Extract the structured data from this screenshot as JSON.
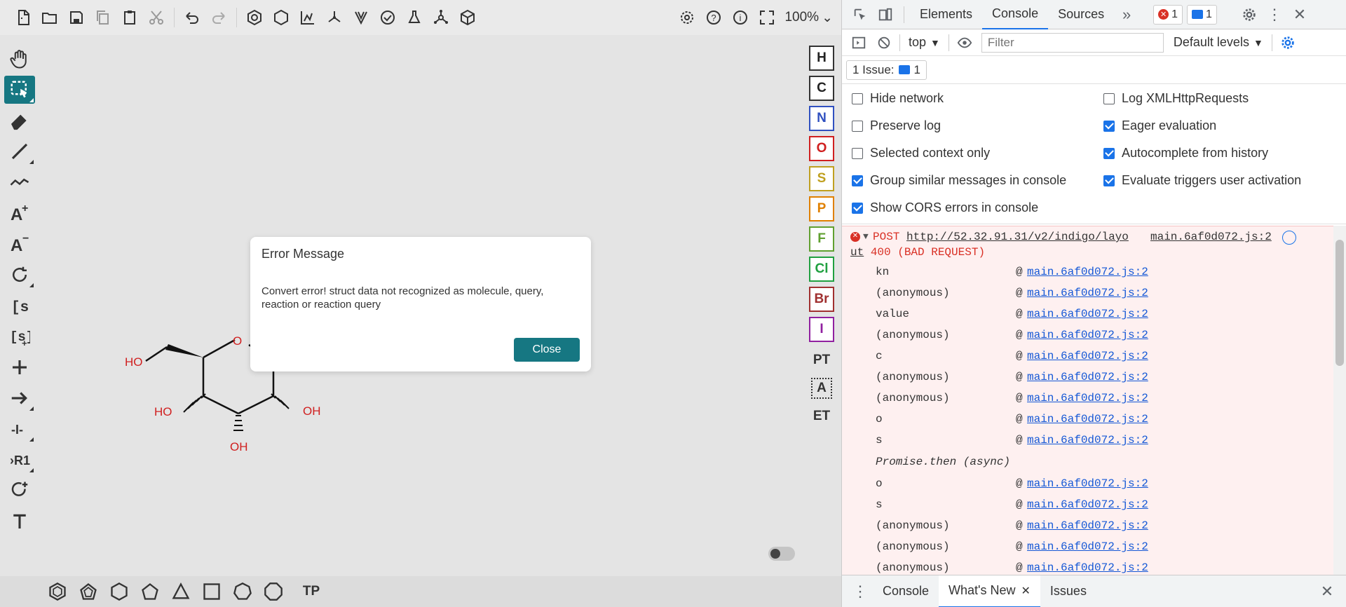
{
  "editor": {
    "top_toolbar": {
      "icons": [
        "new-icon",
        "open-icon",
        "save-icon",
        "copy-icon",
        "paste-icon",
        "cut-icon",
        "undo-icon",
        "redo-icon",
        "aromatize-icon",
        "dearomatize-icon",
        "layout-icon",
        "clean-icon",
        "stereo-icon",
        "check-icon",
        "calculate-icon",
        "explicit-h-icon",
        "3d-icon"
      ],
      "right_icons": [
        "settings-icon",
        "help-icon",
        "about-icon",
        "fullscreen-icon"
      ],
      "zoom": "100%"
    },
    "left_tools": [
      "hand",
      "select",
      "erase",
      "bond",
      "chain",
      "charge-plus",
      "charge-minus",
      "rotate",
      "sgroup",
      "sgroup-add",
      "plus",
      "arrow",
      "bracket",
      "rgroup",
      "rgroup-attach",
      "text"
    ],
    "atoms": [
      {
        "label": "H",
        "color": "#222222"
      },
      {
        "label": "C",
        "color": "#222222"
      },
      {
        "label": "N",
        "color": "#3050c0"
      },
      {
        "label": "O",
        "color": "#d02020"
      },
      {
        "label": "S",
        "color": "#c0a020"
      },
      {
        "label": "P",
        "color": "#e08000"
      },
      {
        "label": "F",
        "color": "#60a030"
      },
      {
        "label": "Cl",
        "color": "#20a040"
      },
      {
        "label": "Br",
        "color": "#a03030"
      },
      {
        "label": "I",
        "color": "#9020a0"
      }
    ],
    "right_extras": {
      "periodic": "PT",
      "any_atom": "A",
      "extended": "ET"
    },
    "bottom_shapes": [
      "benzene",
      "cyclopentadiene",
      "cyclohexane",
      "cyclopentane",
      "cyclopropane",
      "cyclobutane",
      "cycloheptane",
      "cyclooctane"
    ],
    "bottom_template": "TP",
    "molecule_labels": {
      "ho1": "HO",
      "o_ring": "O",
      "ho2": "HO",
      "oh3": "OH",
      "oh4": "OH"
    },
    "dialog": {
      "title": "Error Message",
      "body": "Convert error! struct data not recognized as molecule, query, reaction or reaction query",
      "close": "Close"
    }
  },
  "devtools": {
    "tabs": [
      "Elements",
      "Console",
      "Sources"
    ],
    "active_tab": "Console",
    "error_count": "1",
    "message_count": "1",
    "context": "top",
    "filter_placeholder": "Filter",
    "levels": "Default levels",
    "issues_label": "1 Issue:",
    "issues_count": "1",
    "settings_left": [
      {
        "label": "Hide network",
        "checked": false
      },
      {
        "label": "Preserve log",
        "checked": false
      },
      {
        "label": "Selected context only",
        "checked": false
      },
      {
        "label": "Group similar messages in console",
        "checked": true
      },
      {
        "label": "Show CORS errors in console",
        "checked": true
      }
    ],
    "settings_right": [
      {
        "label": "Log XMLHttpRequests",
        "checked": false
      },
      {
        "label": "Eager evaluation",
        "checked": true
      },
      {
        "label": "Autocomplete from history",
        "checked": true
      },
      {
        "label": "Evaluate triggers user activation",
        "checked": true
      }
    ],
    "error": {
      "method": "POST",
      "url_line1": "http://52.32.91.31/v2/indigo/layo",
      "url_line2": "ut",
      "status": "400 (BAD REQUEST)",
      "source": "main.6af0d072.js:2"
    },
    "stack": [
      {
        "fn": "kn",
        "src": "main.6af0d072.js:2"
      },
      {
        "fn": "(anonymous)",
        "src": "main.6af0d072.js:2"
      },
      {
        "fn": "value",
        "src": "main.6af0d072.js:2"
      },
      {
        "fn": "(anonymous)",
        "src": "main.6af0d072.js:2"
      },
      {
        "fn": "c",
        "src": "main.6af0d072.js:2"
      },
      {
        "fn": "(anonymous)",
        "src": "main.6af0d072.js:2"
      },
      {
        "fn": "(anonymous)",
        "src": "main.6af0d072.js:2"
      },
      {
        "fn": "o",
        "src": "main.6af0d072.js:2"
      },
      {
        "fn": "s",
        "src": "main.6af0d072.js:2"
      }
    ],
    "async_label": "Promise.then (async)",
    "stack2": [
      {
        "fn": "o",
        "src": "main.6af0d072.js:2"
      },
      {
        "fn": "s",
        "src": "main.6af0d072.js:2"
      },
      {
        "fn": "(anonymous)",
        "src": "main.6af0d072.js:2"
      },
      {
        "fn": "(anonymous)",
        "src": "main.6af0d072.js:2"
      },
      {
        "fn": "(anonymous)",
        "src": "main.6af0d072.js:2"
      }
    ],
    "drawer_tabs": [
      "Console",
      "What's New",
      "Issues"
    ],
    "drawer_active": "What's New"
  }
}
